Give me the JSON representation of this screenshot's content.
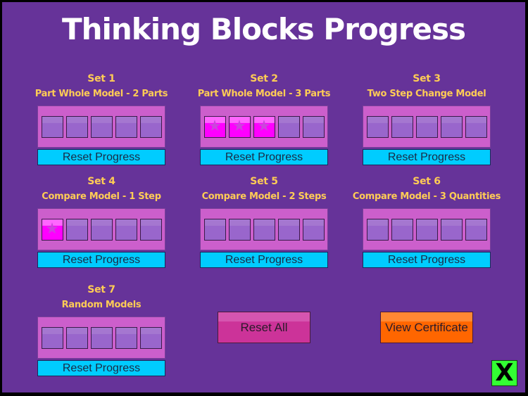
{
  "title": "Thinking Blocks Progress",
  "sets": [
    {
      "number": "Set 1",
      "name": "Part Whole Model - 2 Parts",
      "completed": 0,
      "total": 5,
      "reset_label": "Reset Progress"
    },
    {
      "number": "Set 2",
      "name": "Part Whole Model - 3 Parts",
      "completed": 3,
      "total": 5,
      "reset_label": "Reset Progress"
    },
    {
      "number": "Set 3",
      "name": "Two Step Change Model",
      "completed": 0,
      "total": 5,
      "reset_label": "Reset Progress"
    },
    {
      "number": "Set 4",
      "name": "Compare Model - 1 Step",
      "completed": 1,
      "total": 5,
      "reset_label": "Reset Progress"
    },
    {
      "number": "Set 5",
      "name": "Compare Model - 2 Steps",
      "completed": 0,
      "total": 5,
      "reset_label": "Reset Progress"
    },
    {
      "number": "Set 6",
      "name": "Compare Model - 3 Quantities",
      "completed": 0,
      "total": 5,
      "reset_label": "Reset Progress"
    },
    {
      "number": "Set 7",
      "name": "Random Models",
      "completed": 0,
      "total": 5,
      "reset_label": "Reset Progress"
    }
  ],
  "buttons": {
    "reset_all": "Reset All",
    "view_certificate": "View Certificate",
    "close": "X"
  },
  "icons": {
    "completed_box": "star-icon",
    "close": "close-icon"
  },
  "colors": {
    "background": "#663399",
    "title": "#ffffff",
    "set_label": "#ffcc55",
    "tray": "#cc5fcc",
    "box_empty": "#9966cc",
    "box_done": "#ff00ff",
    "reset_progress": "#00ccff",
    "reset_all": "#cc3399",
    "view_certificate": "#ff6600",
    "close": "#33ff33"
  }
}
